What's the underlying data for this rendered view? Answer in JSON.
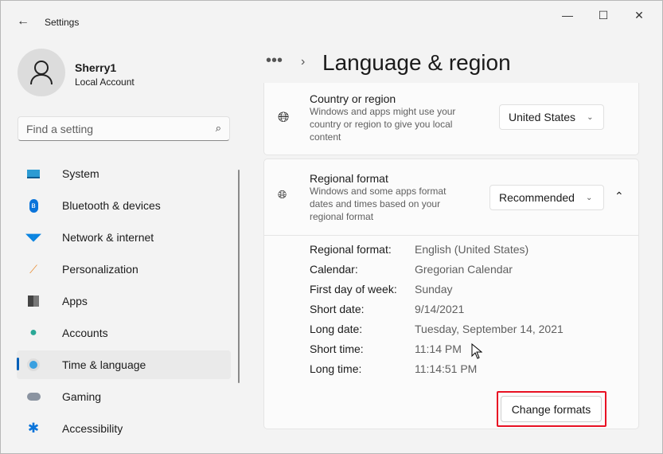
{
  "window": {
    "title": "Settings"
  },
  "profile": {
    "name": "Sherry1",
    "type": "Local Account"
  },
  "search": {
    "placeholder": "Find a setting"
  },
  "nav": [
    {
      "label": "System",
      "icon": "system-icon"
    },
    {
      "label": "Bluetooth & devices",
      "icon": "bluetooth-icon"
    },
    {
      "label": "Network & internet",
      "icon": "wifi-icon"
    },
    {
      "label": "Personalization",
      "icon": "brush-icon"
    },
    {
      "label": "Apps",
      "icon": "apps-icon"
    },
    {
      "label": "Accounts",
      "icon": "person-icon"
    },
    {
      "label": "Time & language",
      "icon": "clock-globe-icon",
      "selected": true
    },
    {
      "label": "Gaming",
      "icon": "gamepad-icon"
    },
    {
      "label": "Accessibility",
      "icon": "accessibility-icon"
    }
  ],
  "header": {
    "breadcrumb_more": "•••",
    "title": "Language & region"
  },
  "country": {
    "title": "Country or region",
    "desc": "Windows and apps might use your country or region to give you local content",
    "value": "United States"
  },
  "regional": {
    "title": "Regional format",
    "desc": "Windows and some apps format dates and times based on your regional format",
    "value": "Recommended",
    "rows": [
      {
        "label": "Regional format:",
        "value": "English (United States)"
      },
      {
        "label": "Calendar:",
        "value": "Gregorian Calendar"
      },
      {
        "label": "First day of week:",
        "value": "Sunday"
      },
      {
        "label": "Short date:",
        "value": "9/14/2021"
      },
      {
        "label": "Long date:",
        "value": "Tuesday, September 14, 2021"
      },
      {
        "label": "Short time:",
        "value": "11:14 PM"
      },
      {
        "label": "Long time:",
        "value": "11:14:51 PM"
      }
    ],
    "button": "Change formats"
  },
  "colors": {
    "accent": "#005fb8",
    "highlight": "#e81123"
  }
}
